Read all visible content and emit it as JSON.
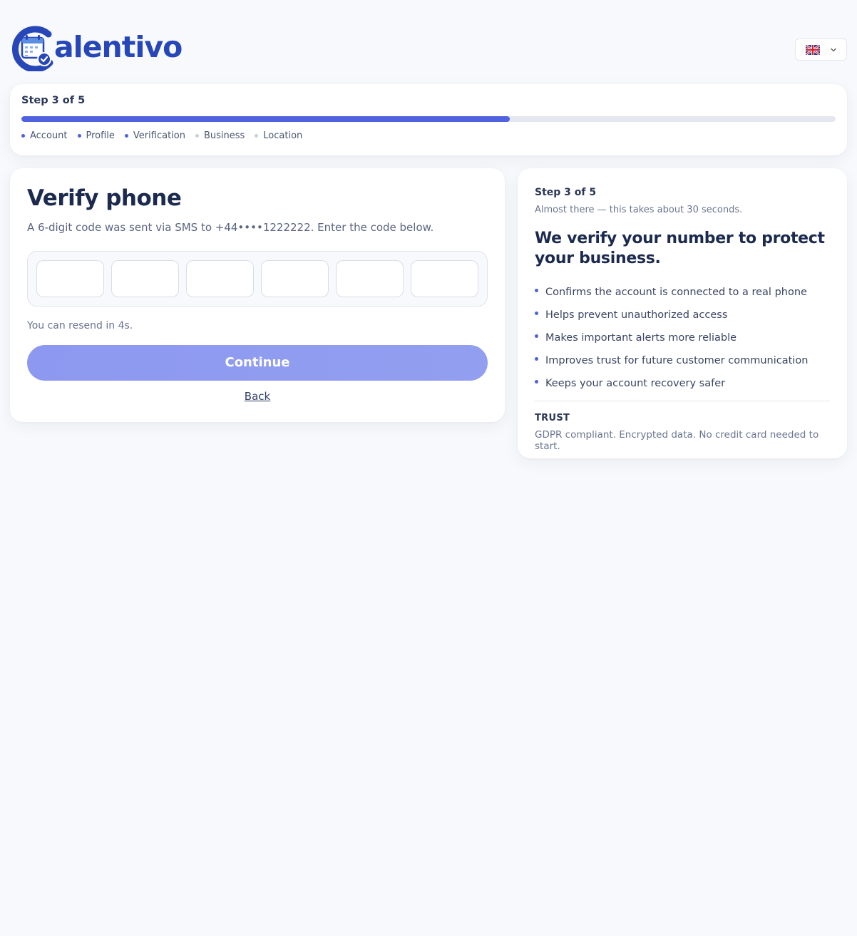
{
  "brand": {
    "name": "alentivo"
  },
  "language": {
    "flag_icon": "uk-flag-icon",
    "dropdown_icon": "chevron-down-icon"
  },
  "progress": {
    "label": "Step 3 of 5",
    "percent": 60,
    "steps": [
      {
        "label": "Account",
        "done": true
      },
      {
        "label": "Profile",
        "done": true
      },
      {
        "label": "Verification",
        "done": true
      },
      {
        "label": "Business",
        "done": false
      },
      {
        "label": "Location",
        "done": false
      }
    ]
  },
  "verify": {
    "title": "Verify phone",
    "subtitle": "A 6‑digit code was sent via SMS to +44••••1222222. Enter the code below.",
    "code_values": [
      "",
      "",
      "",
      "",
      "",
      ""
    ],
    "resend_text": "You can resend in 4s.",
    "continue_label": "Continue",
    "back_label": "Back"
  },
  "side": {
    "step_label": "Step 3 of 5",
    "subtitle": "Almost there — this takes about 30 seconds.",
    "title": "We verify your number to protect your business.",
    "bullets": [
      "Confirms the account is connected to a real phone",
      "Helps prevent unauthorized access",
      "Makes important alerts more reliable",
      "Improves trust for future customer communication",
      "Keeps your account recovery safer"
    ],
    "trust_label": "TRUST",
    "trust_text": "GDPR compliant. Encrypted data. No credit card needed to start."
  },
  "colors": {
    "accent": "#4f63df",
    "brand": "#2746b8",
    "button": "#8d98f0",
    "step_inactive": "#c9cfdd"
  }
}
